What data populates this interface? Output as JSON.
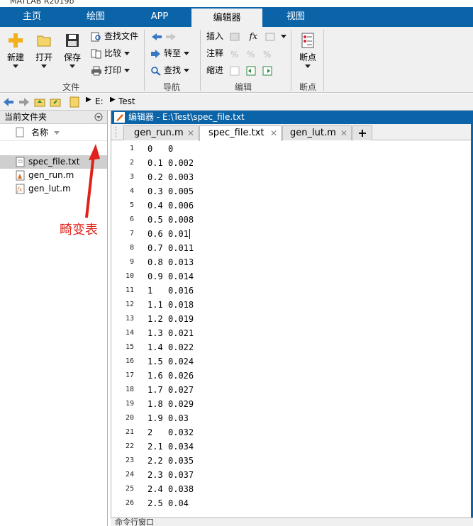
{
  "window": {
    "title": "MATLAB R2019b"
  },
  "main_tabs": [
    {
      "label": "主页"
    },
    {
      "label": "绘图"
    },
    {
      "label": "APP"
    },
    {
      "label": "编辑器"
    },
    {
      "label": "视图"
    }
  ],
  "ribbon": {
    "file": {
      "new": "新建",
      "open": "打开",
      "save": "保存",
      "find_files": "查找文件",
      "compare": "比较",
      "print": "打印",
      "group": "文件"
    },
    "navigate": {
      "goto": "转至",
      "find": "查找",
      "group": "导航"
    },
    "edit": {
      "insert": "插入",
      "comment": "注释",
      "indent": "缩进",
      "fx": "fx",
      "group": "编辑"
    },
    "breakpoints": {
      "label": "断点",
      "group": "断点"
    }
  },
  "path": {
    "drive": "E:",
    "folder": "Test"
  },
  "current_folder": {
    "title": "当前文件夹",
    "name_col": "名称",
    "files": [
      {
        "name": "spec_file.txt"
      },
      {
        "name": "gen_run.m"
      },
      {
        "name": "gen_lut.m"
      }
    ]
  },
  "annotation": "畸变表",
  "editor": {
    "title": "编辑器 - E:\\Test\\spec_file.txt",
    "tabs": [
      {
        "label": "gen_run.m"
      },
      {
        "label": "spec_file.txt"
      },
      {
        "label": "gen_lut.m"
      }
    ],
    "add_tab": "+",
    "close_glyph": "✕",
    "lines": [
      {
        "n": "1",
        "a": "0",
        "b": "0"
      },
      {
        "n": "2",
        "a": "0.1",
        "b": "0.002"
      },
      {
        "n": "3",
        "a": "0.2",
        "b": "0.003"
      },
      {
        "n": "4",
        "a": "0.3",
        "b": "0.005"
      },
      {
        "n": "5",
        "a": "0.4",
        "b": "0.006"
      },
      {
        "n": "6",
        "a": "0.5",
        "b": "0.008"
      },
      {
        "n": "7",
        "a": "0.6",
        "b": "0.01"
      },
      {
        "n": "8",
        "a": "0.7",
        "b": "0.011"
      },
      {
        "n": "9",
        "a": "0.8",
        "b": "0.013"
      },
      {
        "n": "10",
        "a": "0.9",
        "b": "0.014"
      },
      {
        "n": "11",
        "a": "1",
        "b": "0.016"
      },
      {
        "n": "12",
        "a": "1.1",
        "b": "0.018"
      },
      {
        "n": "13",
        "a": "1.2",
        "b": "0.019"
      },
      {
        "n": "14",
        "a": "1.3",
        "b": "0.021"
      },
      {
        "n": "15",
        "a": "1.4",
        "b": "0.022"
      },
      {
        "n": "16",
        "a": "1.5",
        "b": "0.024"
      },
      {
        "n": "17",
        "a": "1.6",
        "b": "0.026"
      },
      {
        "n": "18",
        "a": "1.7",
        "b": "0.027"
      },
      {
        "n": "19",
        "a": "1.8",
        "b": "0.029"
      },
      {
        "n": "20",
        "a": "1.9",
        "b": "0.03"
      },
      {
        "n": "21",
        "a": "2",
        "b": "0.032"
      },
      {
        "n": "22",
        "a": "2.1",
        "b": "0.034"
      },
      {
        "n": "23",
        "a": "2.2",
        "b": "0.035"
      },
      {
        "n": "24",
        "a": "2.3",
        "b": "0.037"
      },
      {
        "n": "25",
        "a": "2.4",
        "b": "0.038"
      },
      {
        "n": "26",
        "a": "2.5",
        "b": "0.04"
      }
    ]
  },
  "command_window": {
    "title": "命令行窗口"
  },
  "colors": {
    "accent": "#0b63a8",
    "annotation": "#e0221b",
    "ribbon_bg": "#f0f0f0"
  }
}
